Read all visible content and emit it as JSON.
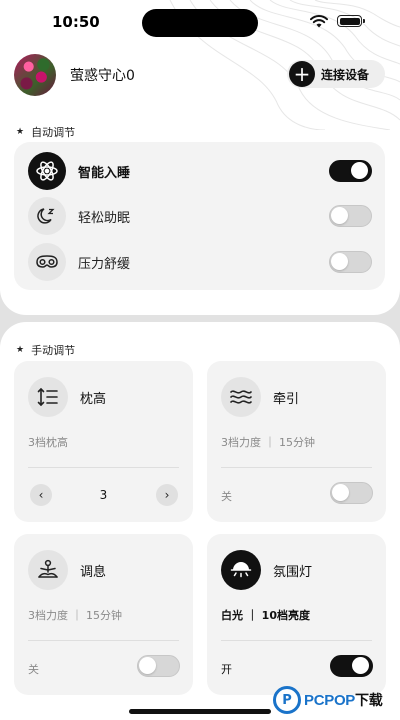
{
  "status_bar": {
    "time": "10:50"
  },
  "profile": {
    "username": "萤惑守心0"
  },
  "connect_button": {
    "label": "连接设备"
  },
  "auto_section": {
    "title": "自动调节",
    "items": [
      {
        "label": "智能入睡",
        "icon": "atom-icon",
        "enabled": true
      },
      {
        "label": "轻松助眠",
        "icon": "moon-zz-icon",
        "enabled": false
      },
      {
        "label": "压力舒缓",
        "icon": "goggles-icon",
        "enabled": false
      }
    ]
  },
  "manual_section": {
    "title": "手动调节",
    "cards": {
      "pillow_height": {
        "title": "枕高",
        "icon": "height-adjust-icon",
        "subtitle": "3档枕高",
        "value": "3",
        "minus": "‹",
        "plus": "›"
      },
      "traction": {
        "title": "牵引",
        "icon": "waves-icon",
        "subtitle": "3档力度 ｜ 15分钟",
        "footer": "关",
        "enabled": false
      },
      "breathing": {
        "title": "调息",
        "icon": "meditation-icon",
        "subtitle": "3档力度 ｜ 15分钟",
        "footer": "关",
        "enabled": false
      },
      "ambient_light": {
        "title": "氛围灯",
        "icon": "lamp-icon",
        "subtitle": "白光 ｜ 10档亮度",
        "footer": "开",
        "enabled": true
      }
    }
  },
  "watermark": {
    "logo": "P",
    "brand": "PCPOP",
    "suffix": "下载"
  },
  "colors": {
    "accent": "#111111",
    "card_bg": "#f3f3f3",
    "page_bg": "#e2e2e2",
    "watermark_blue": "#1a73c9"
  }
}
